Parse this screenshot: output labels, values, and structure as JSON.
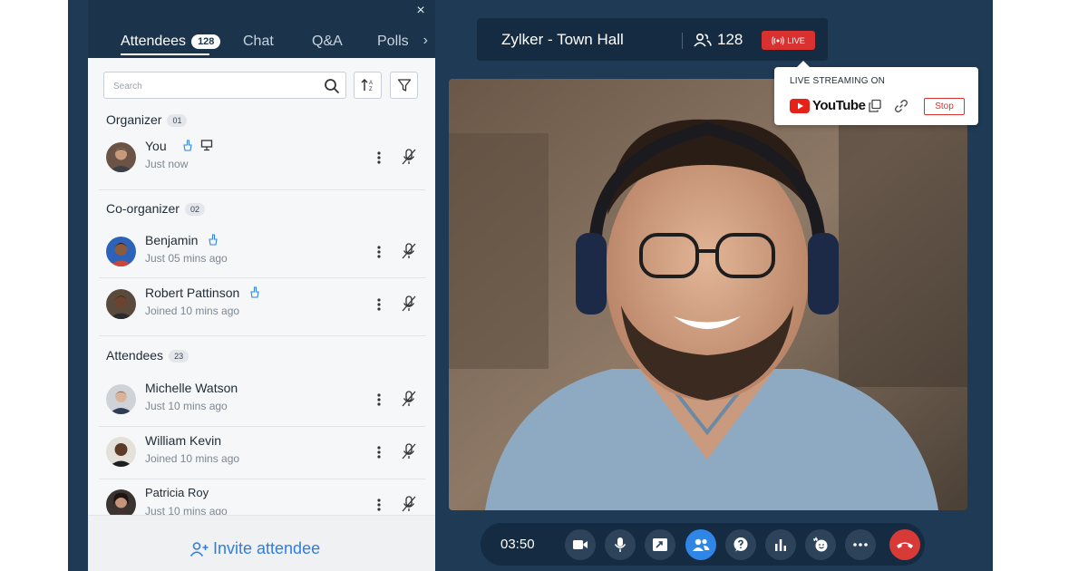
{
  "sidebar": {
    "close": "×",
    "tabs": [
      {
        "label": "Attendees",
        "count": "128"
      },
      {
        "label": "Chat"
      },
      {
        "label": "Q&A"
      },
      {
        "label": "Polls"
      }
    ],
    "more": "›",
    "search_placeholder": "Search",
    "sections": [
      {
        "title": "Organizer",
        "count": "01"
      },
      {
        "title": "Co-organizer",
        "count": "02"
      },
      {
        "title": "Attendees",
        "count": "23"
      }
    ],
    "people": [
      {
        "name": "You",
        "status": "Just now"
      },
      {
        "name": "Benjamin",
        "status": "Just 05 mins ago"
      },
      {
        "name": "Robert Pattinson",
        "status": "Joined 10 mins ago"
      },
      {
        "name": "Michelle Watson",
        "status": "Just 10 mins ago"
      },
      {
        "name": "William Kevin",
        "status": "Joined 10 mins ago"
      },
      {
        "name": "Patricia Roy",
        "status": "Just 10 mins ago"
      }
    ],
    "invite_label": "Invite attendee"
  },
  "header": {
    "title": "Zylker - Town Hall",
    "participants": "128",
    "live_label": "LIVE"
  },
  "stream_popover": {
    "label": "LIVE STREAMING ON",
    "platform": "YouTube",
    "stop_label": "Stop"
  },
  "toolbar": {
    "timer": "03:50",
    "buttons": [
      "camera-icon",
      "microphone-icon",
      "screen-share-icon",
      "participants-icon",
      "qa-icon",
      "poll-icon",
      "reactions-icon",
      "more-icon",
      "end-call-icon"
    ]
  },
  "colors": {
    "background": "#1e3a55",
    "accent": "#2f86e6",
    "live": "#d9312f",
    "link": "#2f7de1"
  }
}
